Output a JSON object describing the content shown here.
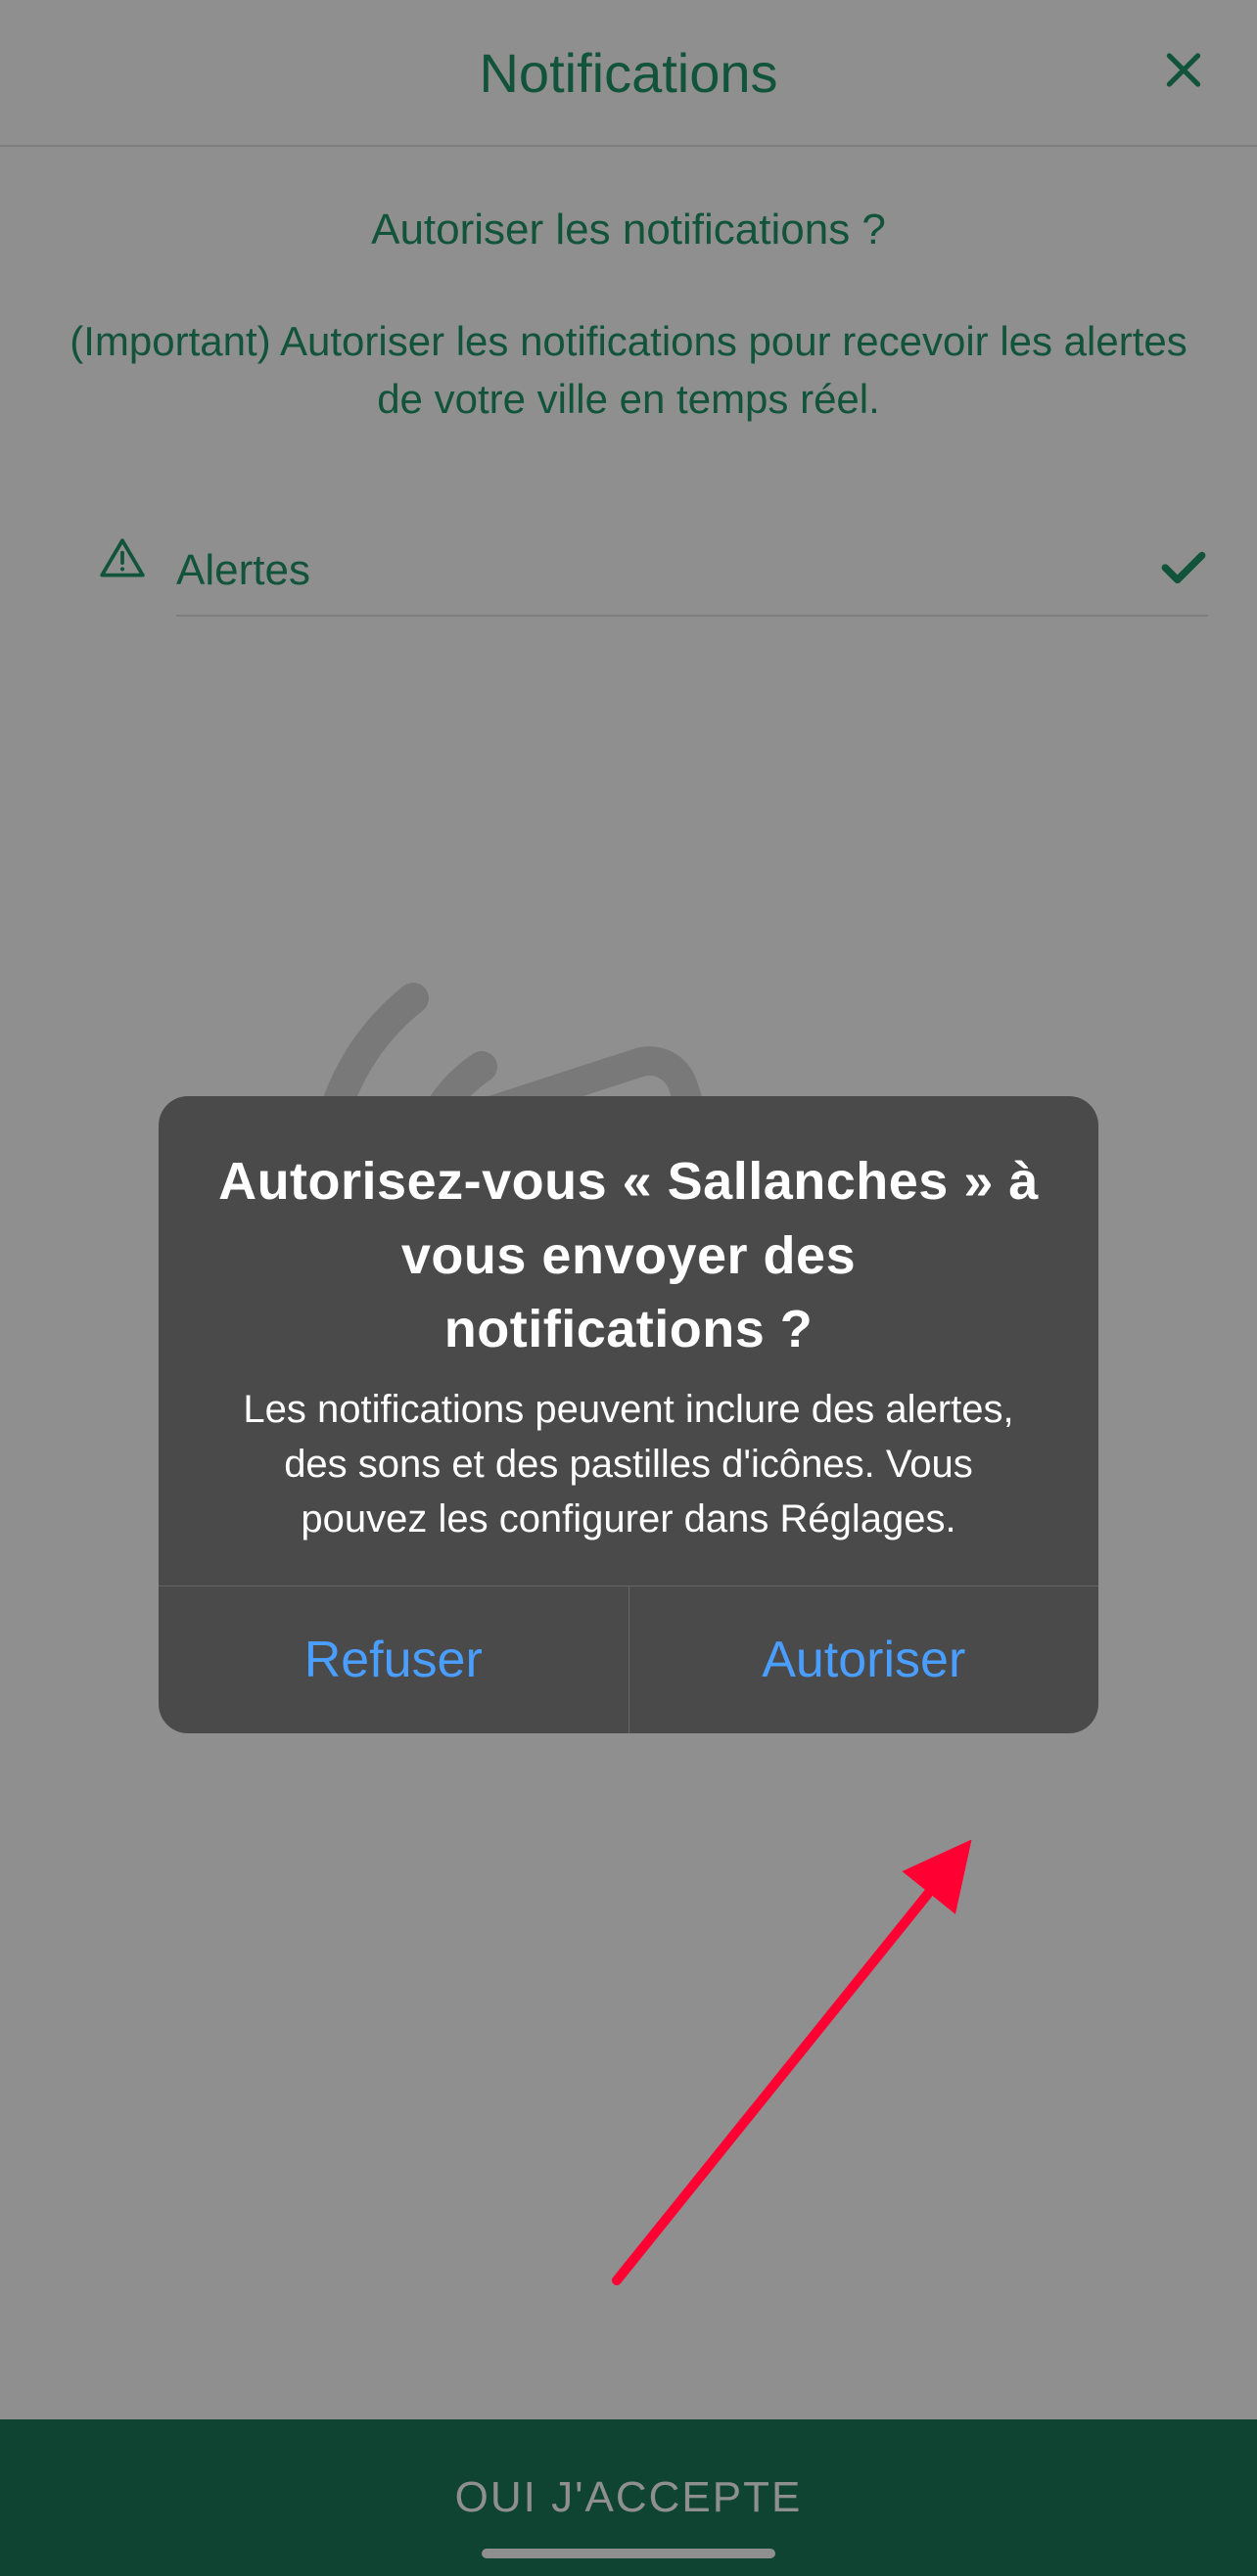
{
  "header": {
    "title": "Notifications"
  },
  "content": {
    "question": "Autoriser les notifications ?",
    "subtitle": "(Important) Autoriser les notifications pour recevoir les alertes de votre ville en temps réel.",
    "alert_label": "Alertes"
  },
  "footer": {
    "accept_label": "OUI J'ACCEPTE"
  },
  "dialog": {
    "title": "Autorisez-vous « Sallanches » à vous envoyer des notifications ?",
    "message": "Les notifications peuvent inclure des alertes, des sons et des pastilles d'icônes. Vous pouvez les configurer dans Réglages.",
    "refuse_label": "Refuser",
    "allow_label": "Autoriser"
  },
  "colors": {
    "accent": "#209469",
    "dialog_bg": "#4a4a4a",
    "dialog_button": "#4a9eff",
    "annotation": "#ff0033"
  }
}
